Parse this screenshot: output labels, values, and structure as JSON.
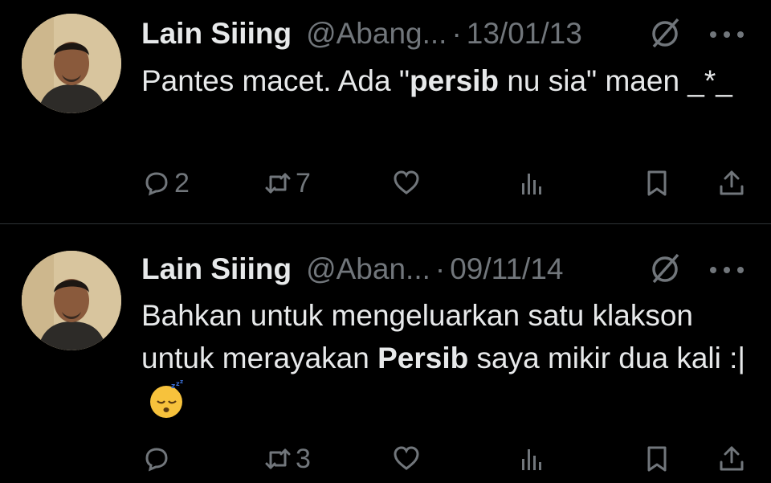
{
  "tweets": [
    {
      "author_name": "Lain Siiing",
      "handle": "@Abang...",
      "date": "13/01/13",
      "text_before": "Pantes macet. Ada \"",
      "text_bold": "persib",
      "text_after": " nu sia\" maen _*_",
      "emoji": "",
      "replies": "2",
      "retweets": "7",
      "likes": ""
    },
    {
      "author_name": "Lain Siiing",
      "handle": "@Aban...",
      "date": "09/11/14",
      "text_before": "Bahkan untuk mengeluarkan satu klakson untuk merayakan ",
      "text_bold": "Persib",
      "text_after": " saya mikir dua kali :|",
      "emoji": "sleeping-face",
      "replies": "",
      "retweets": "3",
      "likes": ""
    }
  ],
  "colors": {
    "background": "#000000",
    "text": "#e7e9ea",
    "muted": "#71767b",
    "divider": "#2f3336"
  },
  "icons": [
    "reply-icon",
    "retweet-icon",
    "like-icon",
    "views-icon",
    "bookmark-icon",
    "share-icon",
    "grok-icon",
    "more-icon"
  ]
}
